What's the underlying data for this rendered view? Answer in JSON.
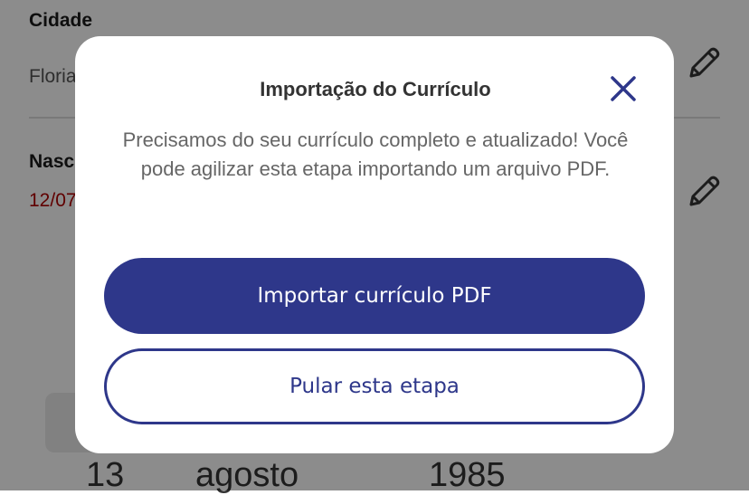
{
  "background": {
    "city_label": "Cidade",
    "city_value": "Floria",
    "birth_label": "Nasci",
    "birth_value": "12/07",
    "picker": {
      "day": "13",
      "month": "agosto",
      "year": "1985"
    }
  },
  "modal": {
    "title": "Importação do Currículo",
    "message": "Precisamos do seu currículo completo e atualizado! Você pode agilizar esta etapa importando um arquivo PDF.",
    "primary_button": "Importar currículo PDF",
    "secondary_button": "Pular esta etapa",
    "accent_color": "#2e378a"
  }
}
